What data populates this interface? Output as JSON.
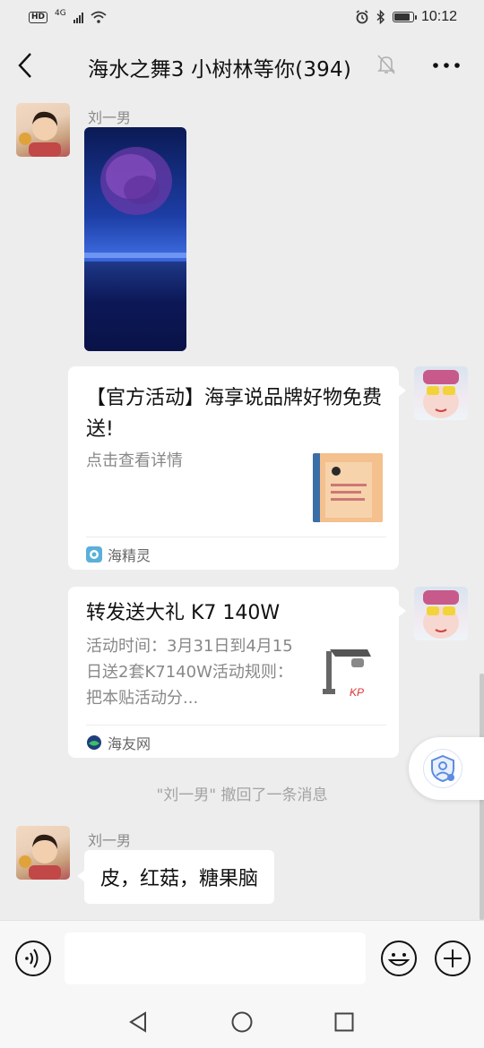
{
  "status_bar": {
    "hd": "HD",
    "network": "4G",
    "time": "10:12"
  },
  "header": {
    "title": "海水之舞3 小树林等你(394)"
  },
  "messages": [
    {
      "type": "image",
      "sender": "刘一男",
      "side": "left"
    },
    {
      "type": "link-card",
      "side": "right",
      "title": "【官方活动】海享说品牌好物免费送!",
      "desc": "点击查看详情",
      "source": "海精灵"
    },
    {
      "type": "link-card",
      "side": "right",
      "title": "转发送大礼 K7 140W",
      "desc": "活动时间：3月31日到4月15日送2套K7140W活动规则：把本贴活动分...",
      "source": "海友网",
      "thumb_text": "KP"
    },
    {
      "type": "system",
      "text": "\"刘一男\" 撤回了一条消息"
    },
    {
      "type": "text",
      "sender": "刘一男",
      "side": "left",
      "text": "皮，红菇，糖果脑"
    }
  ],
  "colors": {
    "background": "#ededed",
    "bubble": "#ffffff",
    "meta_text": "#8a8a8a"
  },
  "icons": {
    "back": "chevron-left-icon",
    "mute": "bell-off-icon",
    "more": "ellipsis-icon",
    "voice": "voice-icon",
    "emoji": "emoji-icon",
    "plus": "plus-icon",
    "float": "shield-person-icon"
  }
}
